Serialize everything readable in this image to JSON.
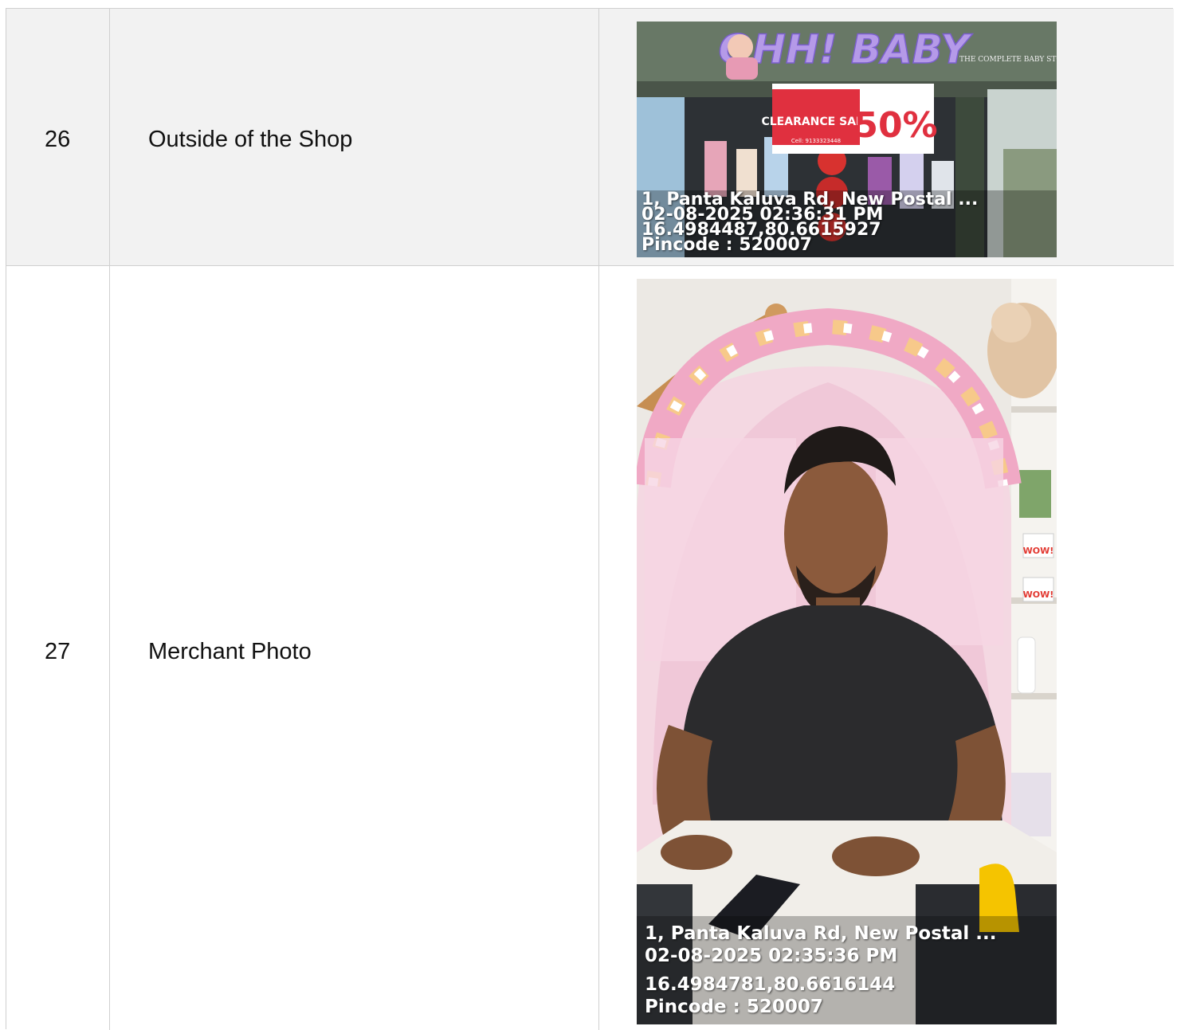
{
  "rows": [
    {
      "number": "26",
      "label": "Outside of the Shop",
      "photo": {
        "sign_brand": "OHH! BABY",
        "sign_tagline": "THE COMPLETE BABY STORE",
        "banner_title": "CLEARANCE SALE",
        "banner_percent": "50%",
        "banner_phone": "Cell: 9133323448",
        "stamp": {
          "address": "1, Panta Kaluva Rd, New Postal ...",
          "datetime": "02-08-2025 02:36:31 PM",
          "coords": "16.4984487,80.6615927",
          "pincode": "Pincode : 520007"
        }
      }
    },
    {
      "number": "27",
      "label": "Merchant Photo",
      "photo": {
        "shelf_tag_1": "WOW!",
        "shelf_tag_2": "WOW!",
        "stamp": {
          "address": "1, Panta Kaluva Rd, New Postal ...",
          "datetime": "02-08-2025 02:35:36 PM",
          "coords": "16.4984781,80.6616144",
          "pincode": "Pincode : 520007"
        }
      }
    }
  ],
  "colors": {
    "row_shaded": "#f2f2f2",
    "border": "#cfcfcf",
    "storefront_green": "#5f6f5c",
    "sign_purple": "#b59ae8",
    "banner_red": "#e0303f"
  }
}
